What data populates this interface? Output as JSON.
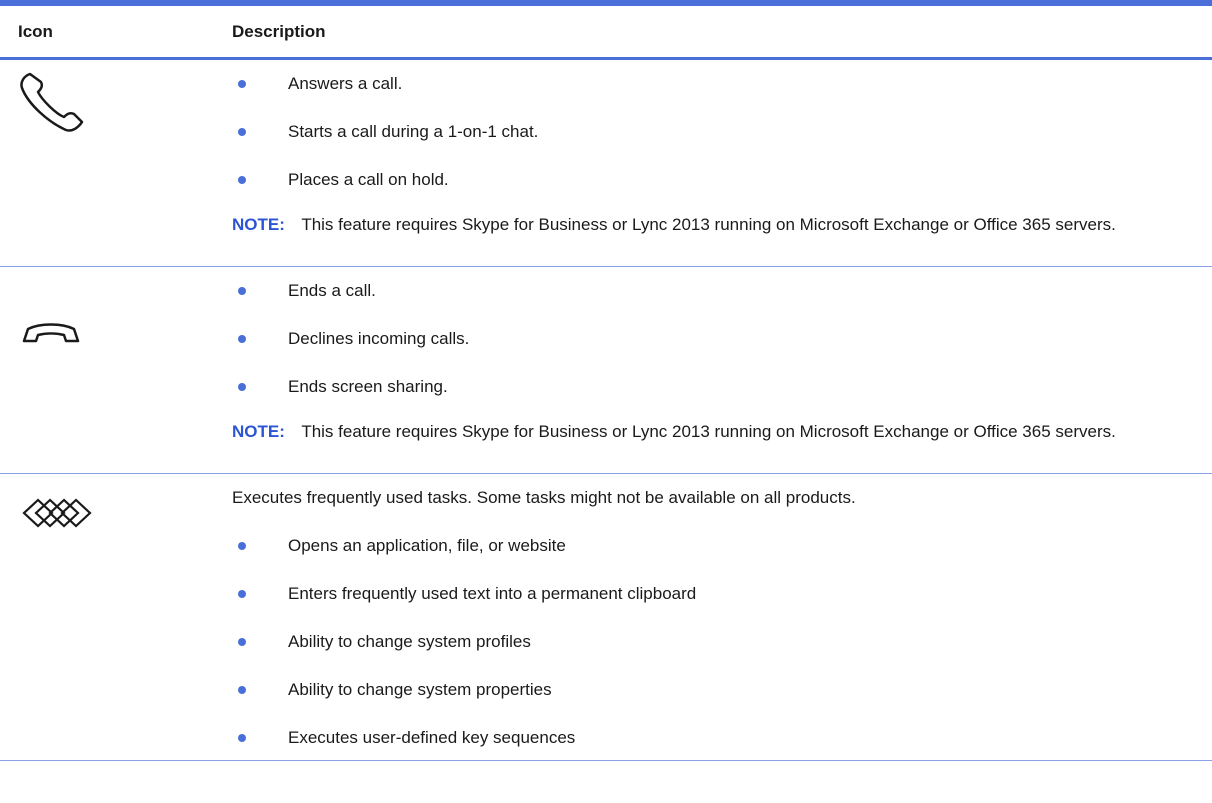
{
  "header": {
    "icon": "Icon",
    "description": "Description"
  },
  "rows": [
    {
      "icon": "phone-answer-icon",
      "bullets": [
        "Answers a call.",
        "Starts a call during a 1-on-1 chat.",
        "Places a call on hold."
      ],
      "note_label": "NOTE:",
      "note_text": "This feature requires Skype for Business or Lync 2013 running on Microsoft Exchange or Office 365 servers."
    },
    {
      "icon": "phone-hangup-icon",
      "bullets": [
        "Ends a call.",
        "Declines incoming calls.",
        "Ends screen sharing."
      ],
      "note_label": "NOTE:",
      "note_text": "This feature requires Skype for Business or Lync 2013 running on Microsoft Exchange or Office 365 servers."
    },
    {
      "icon": "programmable-key-icon",
      "intro": "Executes frequently used tasks. Some tasks might not be available on all products.",
      "bullets": [
        "Opens an application, file, or website",
        "Enters frequently used text into a permanent clipboard",
        "Ability to change system profiles",
        "Ability to change system properties",
        "Executes user-defined key sequences"
      ]
    }
  ],
  "colors": {
    "accent": "#4a6fd8",
    "note_label": "#2b55d4",
    "bullet": "#4a6fd8"
  }
}
